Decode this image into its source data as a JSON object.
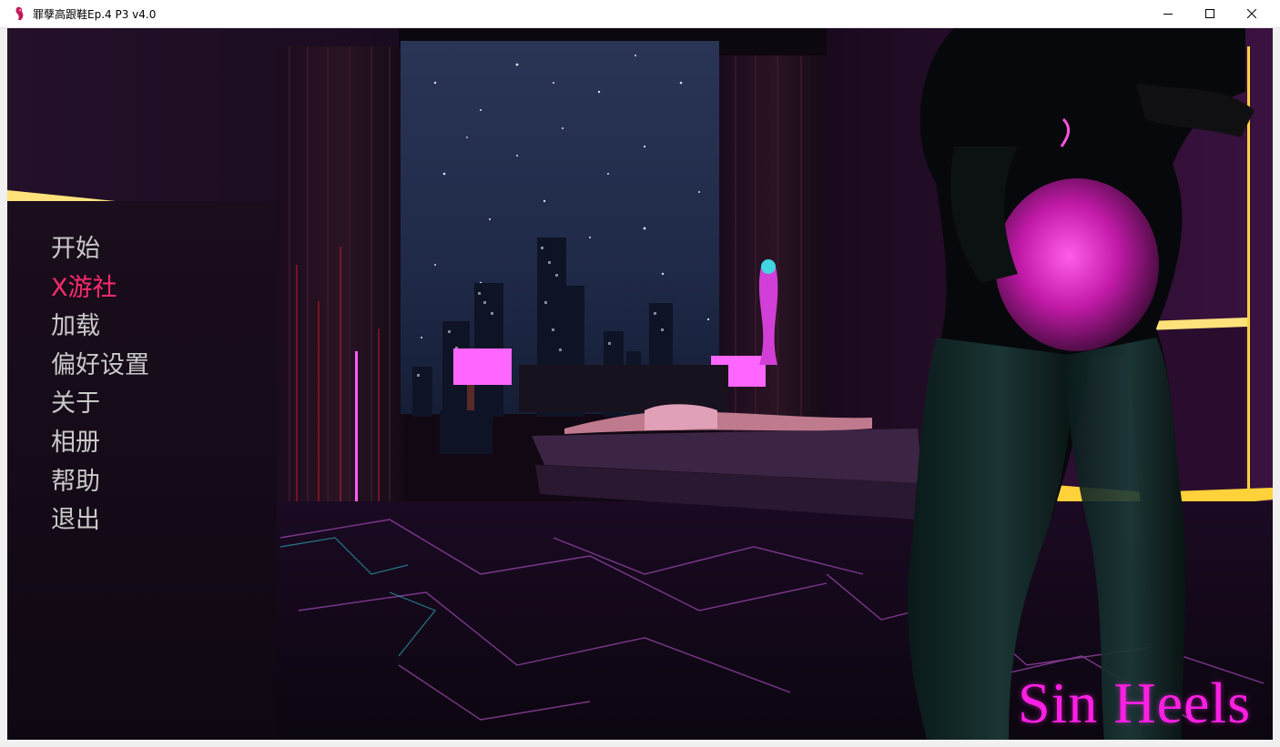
{
  "window": {
    "title": "罪孽高跟鞋Ep.4 P3 v4.0",
    "icons": {
      "app": "sin-heels-app-icon",
      "minimize": "minimize-icon",
      "maximize": "maximize-icon",
      "close": "close-icon"
    }
  },
  "main_menu": {
    "items": [
      {
        "label": "开始",
        "active": false
      },
      {
        "label": "X游社",
        "active": true
      },
      {
        "label": "加载",
        "active": false
      },
      {
        "label": "偏好设置",
        "active": false
      },
      {
        "label": "关于",
        "active": false
      },
      {
        "label": "相册",
        "active": false
      },
      {
        "label": "帮助",
        "active": false
      },
      {
        "label": "退出",
        "active": false
      }
    ]
  },
  "logo": {
    "text": "Sin Heels"
  },
  "colors": {
    "menu_text": "#c9c9c9",
    "menu_active": "#ff2a6d",
    "logo": "#ff1fe4",
    "neon_gold": "#ffe27a",
    "neon_magenta": "#e020e0",
    "night_sky": "#1e2a4a"
  }
}
